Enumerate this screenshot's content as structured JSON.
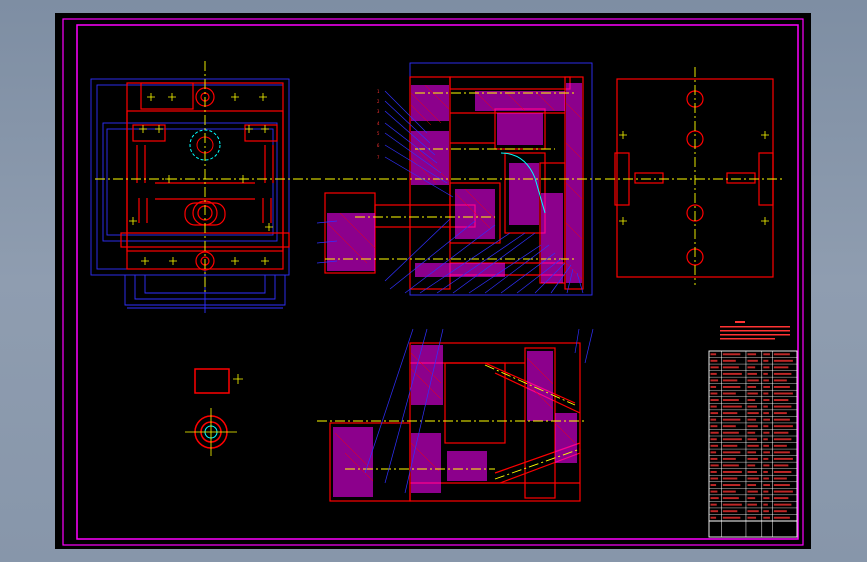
{
  "colors": {
    "background": "#000000",
    "border": "#ff00ff",
    "part": "#ff0000",
    "hatch": "#ff00ff",
    "centerline": "#ffff00",
    "dimension": "#3030ff",
    "hidden": "#00ffff",
    "table_line": "#ffffff",
    "table_text": "#ff3333"
  },
  "drawing": {
    "title_block": {
      "rows": 26,
      "columns": 5
    }
  }
}
